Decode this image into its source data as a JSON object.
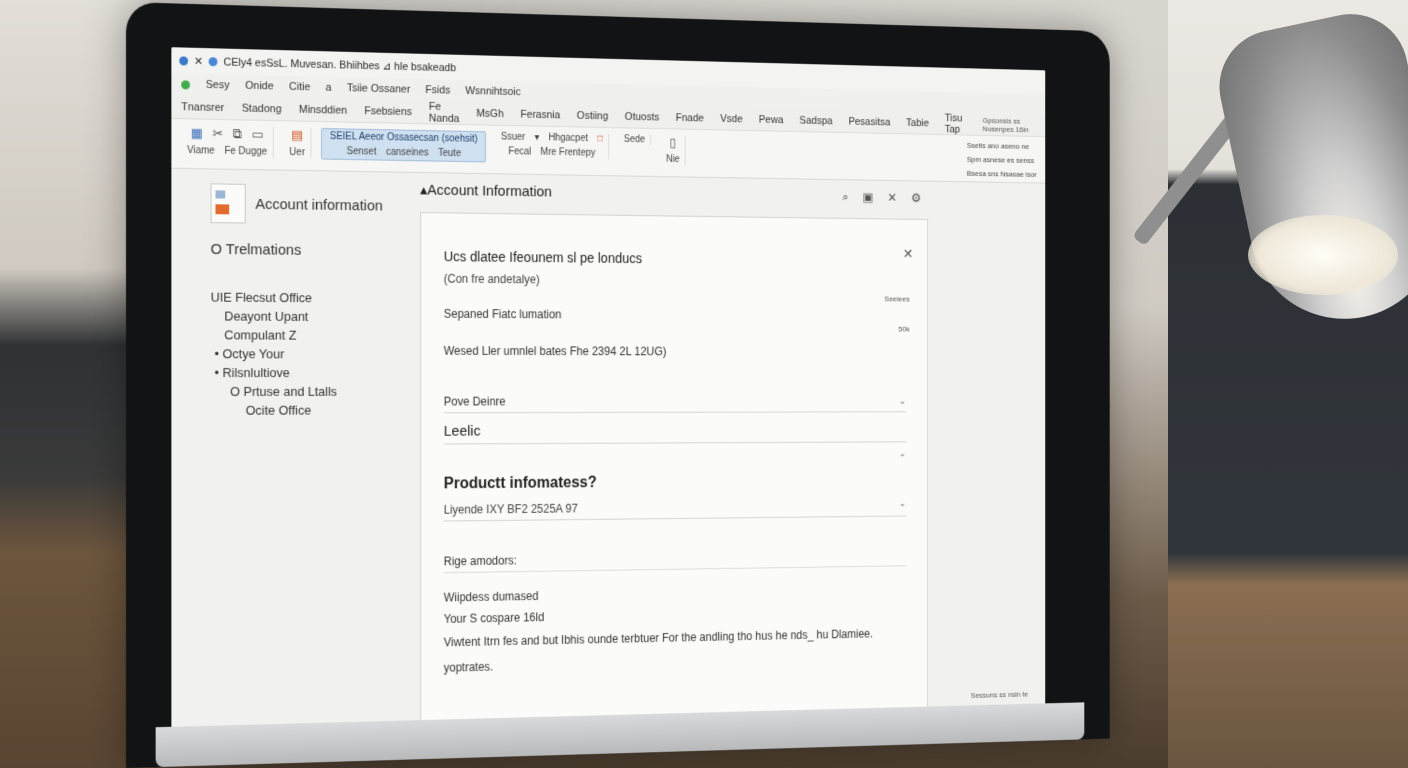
{
  "titlebar": {
    "title": "CEly4 esSsL. Muvesan. Bhiihbes ⊿ hle bsakeadb"
  },
  "menubar": {
    "items": [
      "Sesy",
      "Onide",
      "Citie",
      "a",
      "Tsiie Ossaner",
      "Fsids",
      "Wsnnihtsoic"
    ]
  },
  "tabsbar": {
    "items": [
      "Tnansrer",
      "Stadong",
      "Minsddien",
      "Fsebsiens",
      "Fe Nanda",
      "MsGh",
      "Ferasnia",
      "Ostiing",
      "Otuosts",
      "Fnade",
      "Vsde",
      "Pewa",
      "Sadspa",
      "Pesasitsa",
      "Tabie",
      "Tisu Tap"
    ],
    "right_note": "Gpsonsis ss Nosenpes 16ln"
  },
  "ribbon": {
    "group1_labels": [
      "Viame",
      "Fe Dugge"
    ],
    "group2_label": "Uer",
    "highlight_top": "SEIEL Aeeor Ossasecsan (soehsit)",
    "highlight_labels": [
      "Senset",
      "canseines",
      "Teute"
    ],
    "group4_top": [
      "Ssuer",
      "Hhgacpet"
    ],
    "group4_labels": [
      "Fecal",
      "Mre Frentepy"
    ],
    "group5_label": "Sede",
    "group6_label": "Nie",
    "right_lines": [
      "Ssetis ano aseno ne",
      "Spm asnese es senss",
      "Bsesa sns Nsasae isor"
    ]
  },
  "left": {
    "account_title": "Account information",
    "nav_heading": "Trelmations",
    "items": [
      "UIE Flecsut Office",
      "Deayont Upant",
      "Compulant Z",
      "Octye Your",
      "Rilsnlultiove",
      "Prtuse and Ltalls",
      "Ocite Office"
    ]
  },
  "main": {
    "title": "Account Information"
  },
  "card": {
    "title": "Ucs dlatee Ifeounem sl pe londucs",
    "subtitle": "(Con fre andetalye)",
    "side_note_1": "Seeiees",
    "side_note_2": "50k",
    "separated_label": "Sepaned Fiatc lumation",
    "weekly_line": "Wesed Ller umnlel bates Fhe 2394 2L 12UG)",
    "select_label": "Pove Deinre",
    "select_value": "Leelic",
    "product_title": "Productt infomatess?",
    "product_sub": "Liyende IXY BF2 2525A 97",
    "section_label": "Rige amodors:",
    "line1": "Wiipdess dumased",
    "line2": "Your S cospare 16ld",
    "line3": "Viwtent Itrn fes and but Ibhis ounde terbtuer For the andling tho hus he nds_ hu Dlamiee.",
    "line4": "yoptrates."
  },
  "status": {
    "text": "Sessuns ss nsin te"
  }
}
